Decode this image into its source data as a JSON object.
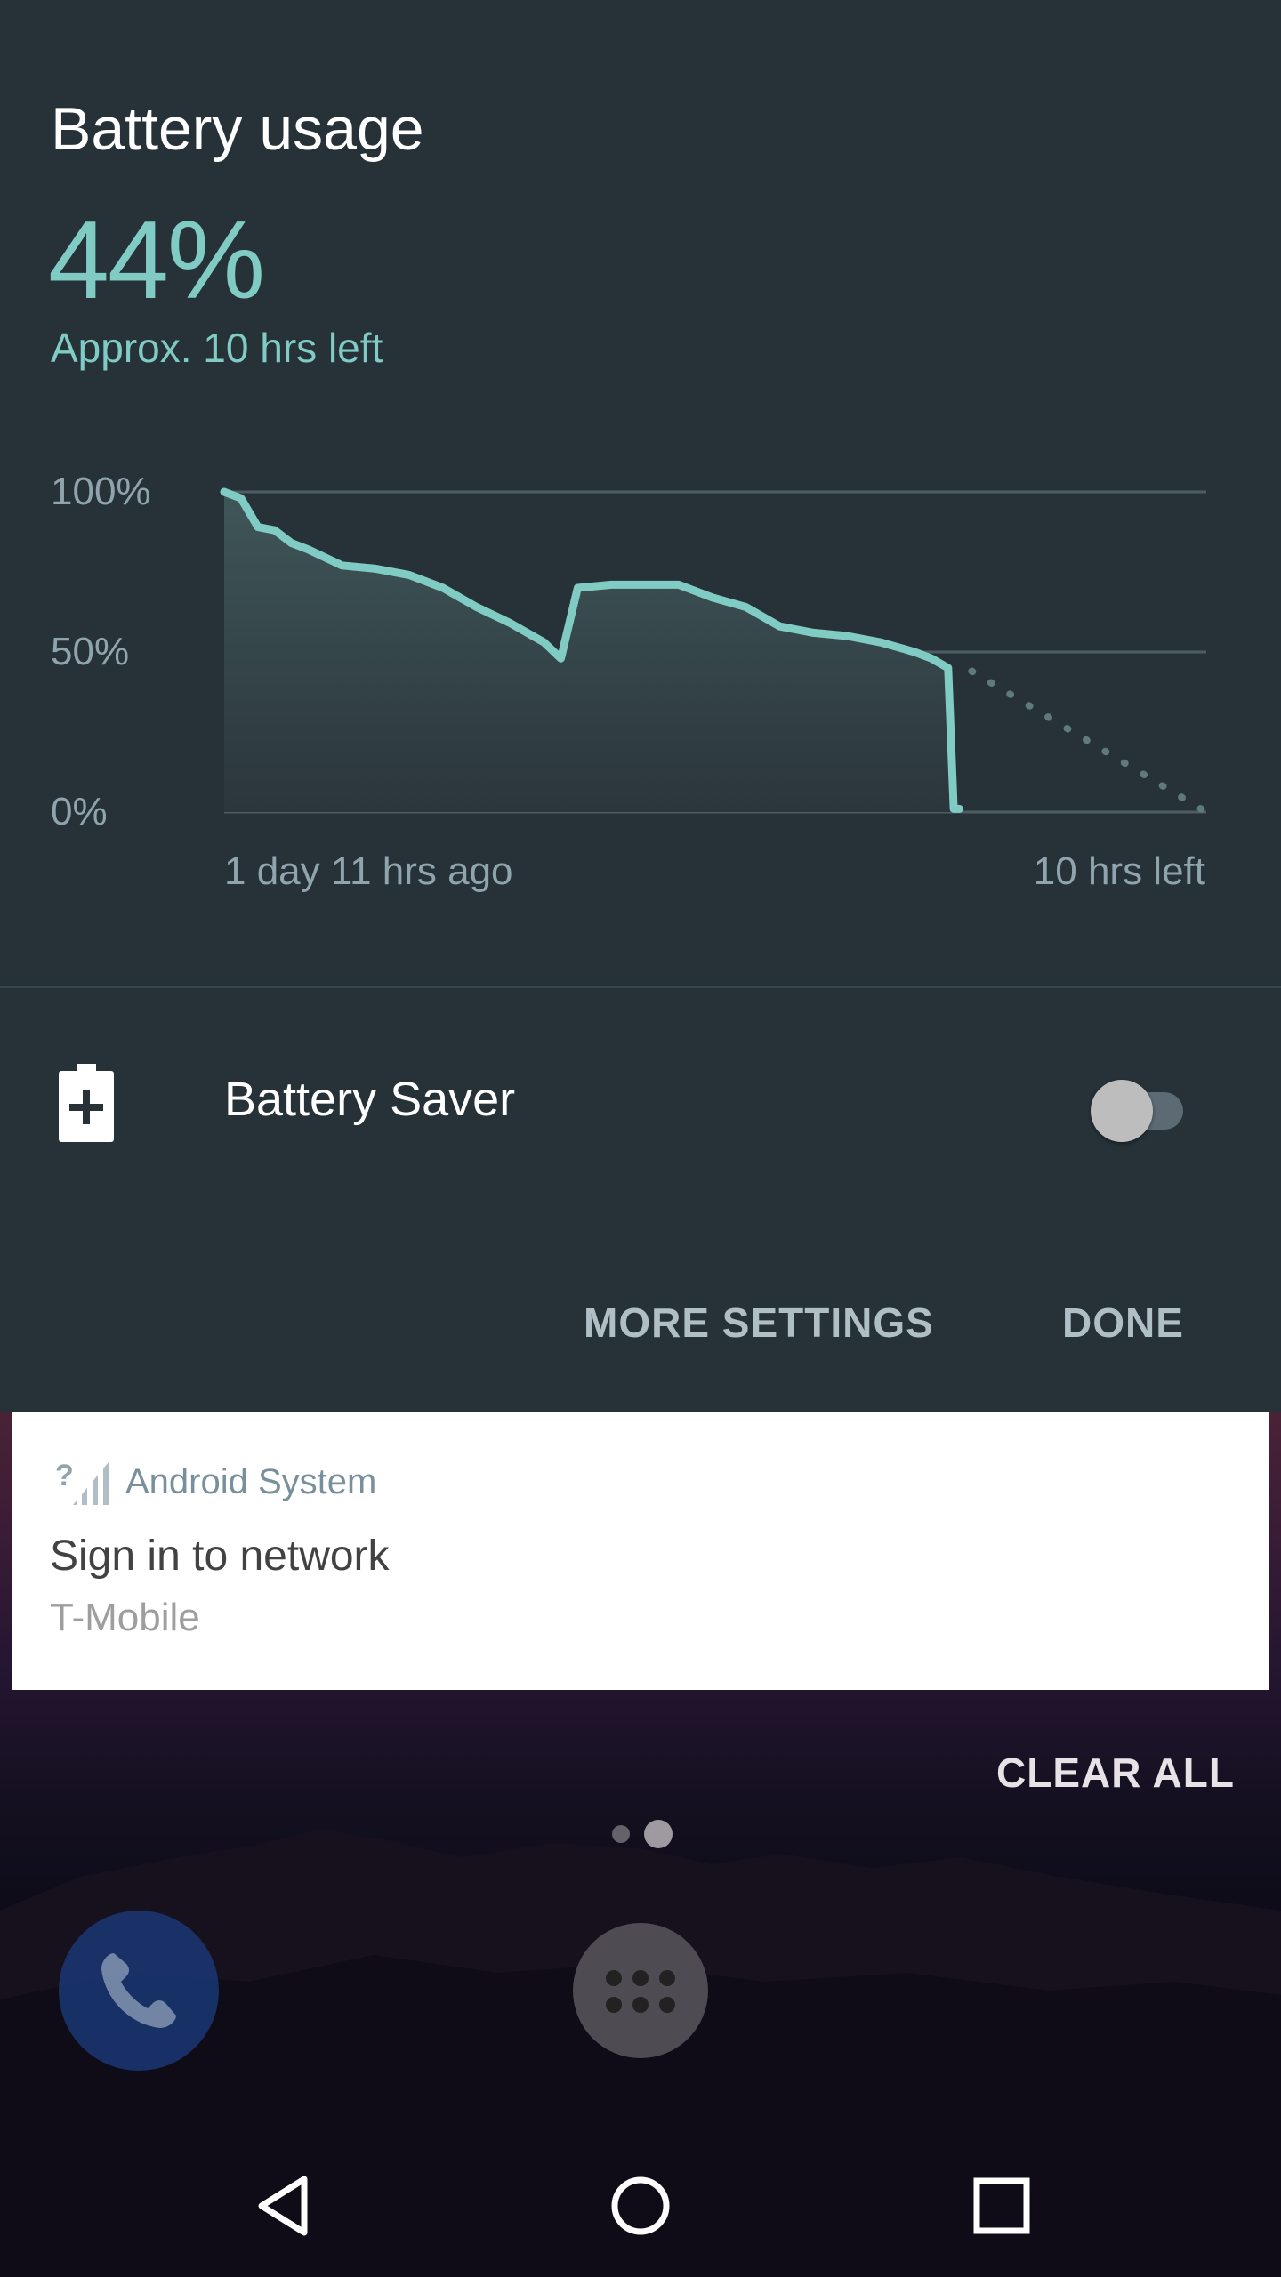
{
  "battery": {
    "title": "Battery usage",
    "percent": "44%",
    "estimate": "Approx. 10 hrs left",
    "accent_color": "#80cbc4"
  },
  "chart_data": {
    "type": "area",
    "y_tick_labels": [
      "100%",
      "50%",
      "0%"
    ],
    "ylim": [
      0,
      100
    ],
    "x_tick_labels": [
      "1 day 11 hrs ago",
      "10 hrs left"
    ],
    "series": [
      {
        "x": [
          0,
          0.6,
          1.2,
          1.8,
          2.4,
          3.0,
          4.2,
          5.4,
          6.6,
          7.8,
          9.0,
          10.2,
          11.4,
          12.0,
          12.6,
          13.8,
          15.0,
          16.2,
          17.4,
          18.6,
          19.8,
          21.0,
          22.2,
          23.4,
          24.6,
          25.2,
          25.8,
          26.0,
          26.2
        ],
        "values": [
          100,
          98,
          89,
          88,
          84,
          82,
          77,
          76,
          74,
          70,
          64,
          59,
          53,
          48,
          70,
          71,
          71,
          71,
          67,
          64,
          58,
          56,
          55,
          53,
          50,
          48,
          45,
          1,
          1
        ]
      }
    ],
    "projection": {
      "x": [
        26.2,
        35
      ],
      "values": [
        44,
        0
      ]
    },
    "grid": true
  },
  "saver": {
    "label": "Battery Saver",
    "enabled": false
  },
  "actions": {
    "more_settings": "MORE SETTINGS",
    "done": "DONE"
  },
  "notification": {
    "app": "Android System",
    "title": "Sign in to network",
    "text": "T-Mobile"
  },
  "recents": {
    "clear_all": "CLEAR ALL"
  },
  "icons": {
    "battery_saver": "battery-plus-icon",
    "notif": "signal-unknown-icon",
    "phone": "phone-icon",
    "apps": "app-drawer-icon",
    "back": "back-icon",
    "home": "home-icon",
    "recents": "recents-icon"
  }
}
